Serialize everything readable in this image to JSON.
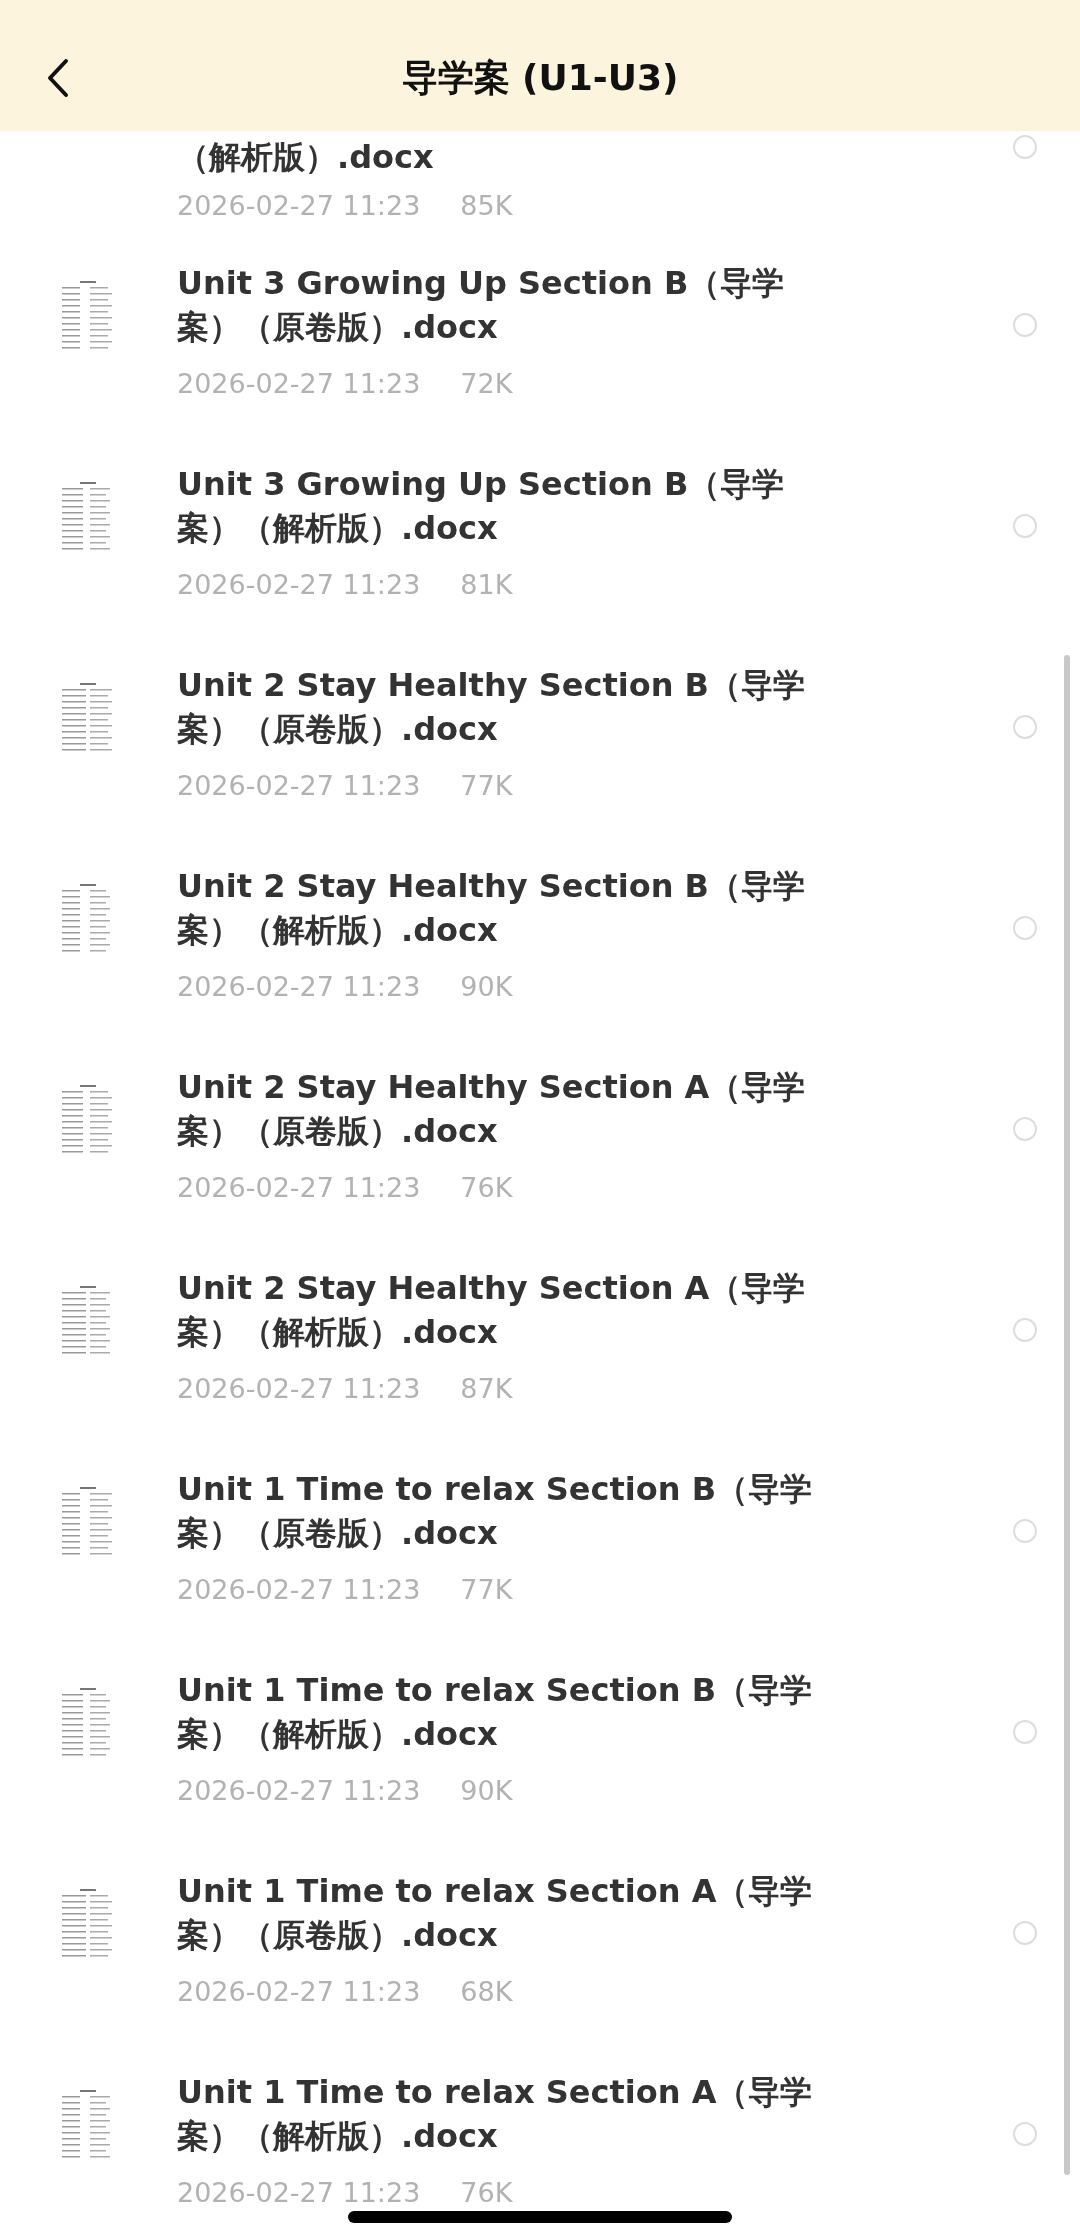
{
  "header": {
    "title": "导学案 (U1-U3)"
  },
  "files": [
    {
      "title": "（解析版）.docx",
      "date": "2026-02-27 11:23",
      "size": "85K",
      "selected": false,
      "partial": true
    },
    {
      "title": "Unit 3 Growing Up  Section B（导学案）（原卷版）.docx",
      "date": "2026-02-27 11:23",
      "size": "72K",
      "selected": false
    },
    {
      "title": "Unit 3 Growing Up  Section B（导学案）（解析版）.docx",
      "date": "2026-02-27 11:23",
      "size": "81K",
      "selected": false
    },
    {
      "title": "Unit 2 Stay Healthy  Section B（导学案）（原卷版）.docx",
      "date": "2026-02-27 11:23",
      "size": "77K",
      "selected": false
    },
    {
      "title": "Unit 2 Stay Healthy  Section B（导学案）（解析版）.docx",
      "date": "2026-02-27 11:23",
      "size": "90K",
      "selected": false
    },
    {
      "title": "Unit 2 Stay Healthy  Section A（导学案）（原卷版）.docx",
      "date": "2026-02-27 11:23",
      "size": "76K",
      "selected": false
    },
    {
      "title": "Unit 2 Stay Healthy  Section A（导学案）（解析版）.docx",
      "date": "2026-02-27 11:23",
      "size": "87K",
      "selected": false
    },
    {
      "title": "Unit 1 Time to relax  Section B（导学案）（原卷版）.docx",
      "date": "2026-02-27 11:23",
      "size": "77K",
      "selected": false
    },
    {
      "title": "Unit 1 Time to relax  Section B（导学案）（解析版）.docx",
      "date": "2026-02-27 11:23",
      "size": "90K",
      "selected": false
    },
    {
      "title": "Unit 1 Time to relax  Section A（导学案）（原卷版）.docx",
      "date": "2026-02-27 11:23",
      "size": "68K",
      "selected": false
    },
    {
      "title": "Unit 1 Time to relax  Section A（导学案）（解析版）.docx",
      "date": "2026-02-27 11:23",
      "size": "76K",
      "selected": false
    }
  ]
}
